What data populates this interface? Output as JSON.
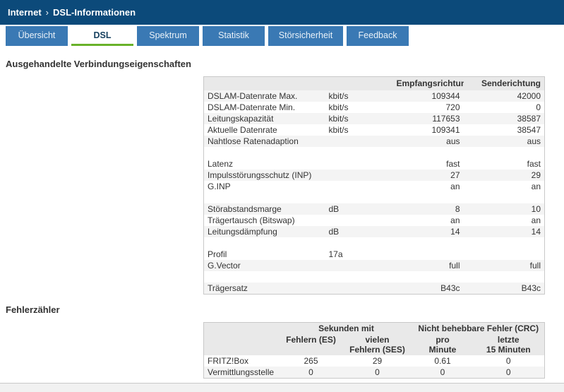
{
  "breadcrumb": {
    "section": "Internet",
    "separator": "›",
    "page": "DSL-Informationen"
  },
  "tabs": [
    {
      "label": "Übersicht",
      "active": false
    },
    {
      "label": "DSL",
      "active": true
    },
    {
      "label": "Spektrum",
      "active": false
    },
    {
      "label": "Statistik",
      "active": false
    },
    {
      "label": "Störsicherheit",
      "active": false,
      "wide": true
    },
    {
      "label": "Feedback",
      "active": false
    }
  ],
  "connection": {
    "heading": "Ausgehandelte Verbindungseigenschaften",
    "columns": {
      "rx": "Empfangsrichtung",
      "tx": "Senderichtung"
    },
    "rows": [
      {
        "label": "DSLAM-Datenrate Max.",
        "unit": "kbit/s",
        "rx": "109344",
        "tx": "42000",
        "shade": true
      },
      {
        "label": "DSLAM-Datenrate Min.",
        "unit": "kbit/s",
        "rx": "720",
        "tx": "0",
        "shade": false
      },
      {
        "label": "Leitungskapazität",
        "unit": "kbit/s",
        "rx": "117653",
        "tx": "38587",
        "shade": true
      },
      {
        "label": "Aktuelle Datenrate",
        "unit": "kbit/s",
        "rx": "109341",
        "tx": "38547",
        "shade": false
      },
      {
        "label": "Nahtlose Ratenadaption",
        "unit": "",
        "rx": "aus",
        "tx": "aus",
        "shade": true
      },
      {
        "separator": true
      },
      {
        "label": "Latenz",
        "unit": "",
        "rx": "fast",
        "tx": "fast",
        "shade": false
      },
      {
        "label": "Impulsstörungsschutz (INP)",
        "unit": "",
        "rx": "27",
        "tx": "29",
        "shade": true
      },
      {
        "label": "G.INP",
        "unit": "",
        "rx": "an",
        "tx": "an",
        "shade": false
      },
      {
        "separator": true
      },
      {
        "label": "Störabstandsmarge",
        "unit": "dB",
        "rx": "8",
        "tx": "10",
        "shade": true
      },
      {
        "label": "Trägertausch (Bitswap)",
        "unit": "",
        "rx": "an",
        "tx": "an",
        "shade": false
      },
      {
        "label": "Leitungsdämpfung",
        "unit": "dB",
        "rx": "14",
        "tx": "14",
        "shade": true
      },
      {
        "separator": true
      },
      {
        "label": "Profil",
        "unit": "17a",
        "rx": "",
        "tx": "",
        "shade": false
      },
      {
        "label": "G.Vector",
        "unit": "",
        "rx": "full",
        "tx": "full",
        "shade": true
      },
      {
        "separator": true
      },
      {
        "label": "Trägersatz",
        "unit": "",
        "rx": "B43c",
        "tx": "B43c",
        "shade": true
      }
    ]
  },
  "errors": {
    "heading": "Fehlerzähler",
    "group_headers": {
      "seconds": "Sekunden mit",
      "crc": "Nicht behebbare Fehler (CRC)"
    },
    "col_headers": {
      "es": "Fehlern (ES)",
      "ses": "vielen\nFehlern (SES)",
      "per_minute": "pro\nMinute",
      "last15": "letzte\n15 Minuten"
    },
    "rows": [
      {
        "label": "FRITZ!Box",
        "es": "265",
        "ses": "29",
        "per_minute": "0.61",
        "last15": "0",
        "shade": false
      },
      {
        "label": "Vermittlungsstelle",
        "es": "0",
        "ses": "0",
        "per_minute": "0",
        "last15": "0",
        "shade": true
      }
    ]
  }
}
